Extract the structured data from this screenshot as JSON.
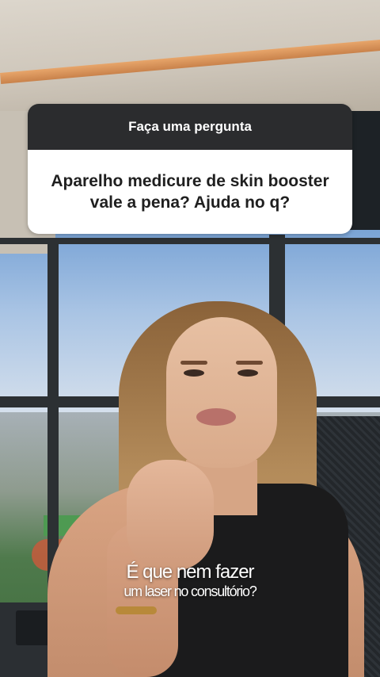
{
  "question_box": {
    "header": "Faça uma pergunta",
    "question": "Aparelho medicure de skin booster vale a pena? Ajuda no q?"
  },
  "caption": {
    "line1": "É que nem fazer",
    "line2": "um laser no consultório?"
  }
}
